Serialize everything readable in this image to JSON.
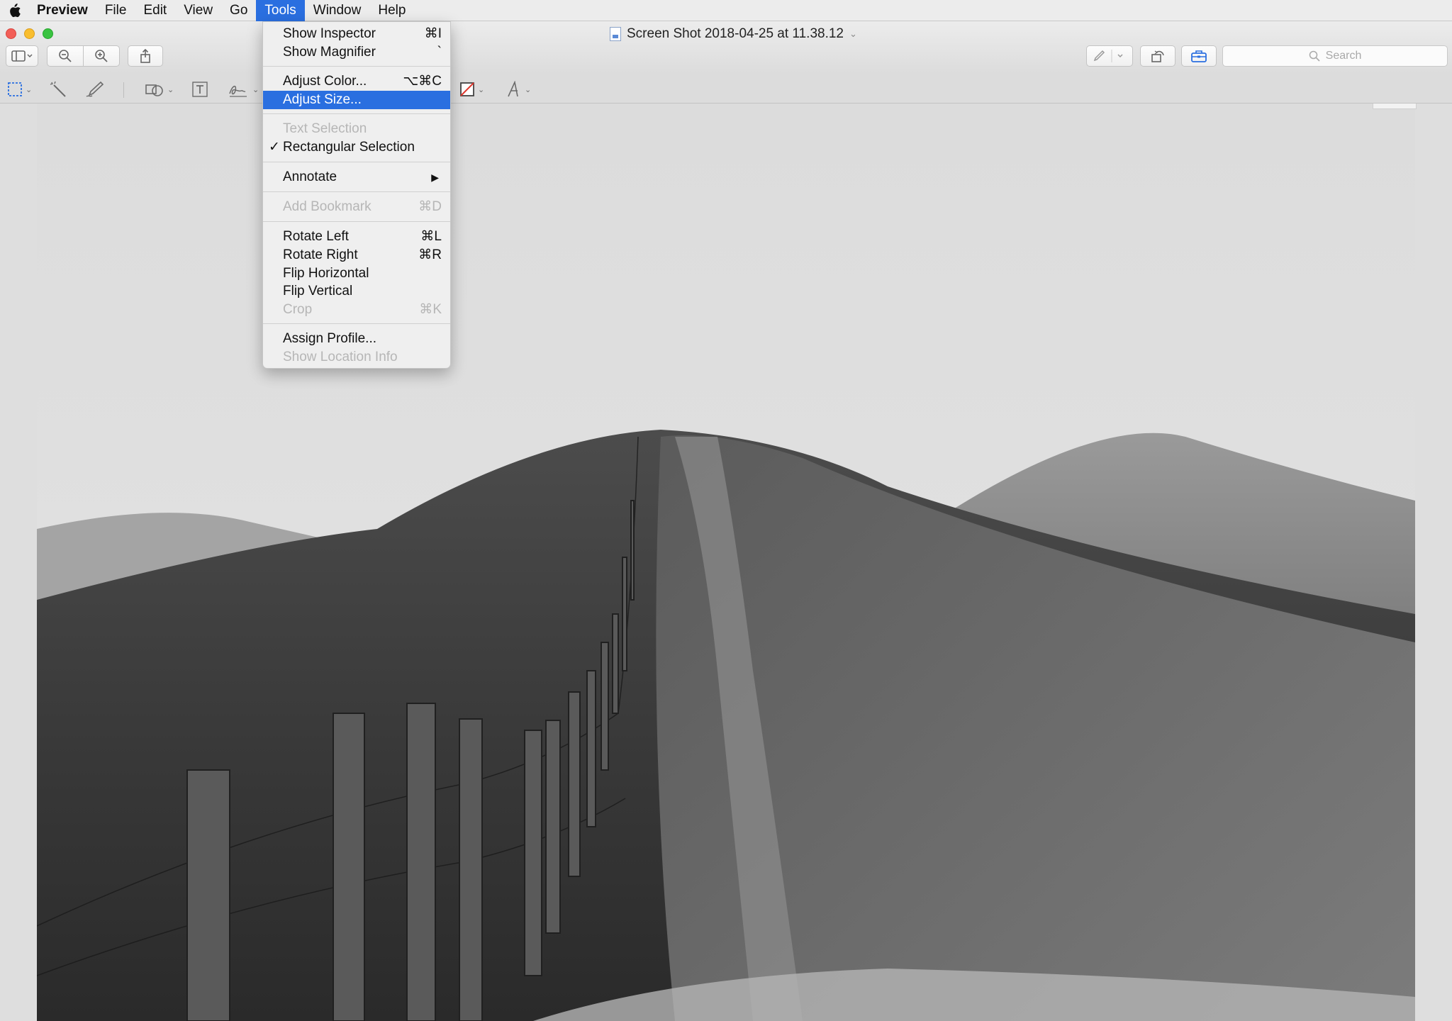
{
  "menubar": {
    "app": "Preview",
    "items": [
      "File",
      "Edit",
      "View",
      "Go",
      "Tools",
      "Window",
      "Help"
    ],
    "active_item": "Tools"
  },
  "window": {
    "title": "Screen Shot 2018-04-25 at 11.38.12",
    "search_placeholder": "Search"
  },
  "tools_menu": {
    "show_inspector": {
      "label": "Show Inspector",
      "shortcut": "⌘I"
    },
    "show_magnifier": {
      "label": "Show Magnifier",
      "shortcut": "`"
    },
    "adjust_color": {
      "label": "Adjust Color...",
      "shortcut": "⌥⌘C"
    },
    "adjust_size": {
      "label": "Adjust Size..."
    },
    "text_selection": {
      "label": "Text Selection"
    },
    "rect_selection": {
      "label": "Rectangular Selection",
      "check": "✓"
    },
    "annotate": {
      "label": "Annotate",
      "arrow": "▶"
    },
    "add_bookmark": {
      "label": "Add Bookmark",
      "shortcut": "⌘D"
    },
    "rotate_left": {
      "label": "Rotate Left",
      "shortcut": "⌘L"
    },
    "rotate_right": {
      "label": "Rotate Right",
      "shortcut": "⌘R"
    },
    "flip_horizontal": {
      "label": "Flip Horizontal"
    },
    "flip_vertical": {
      "label": "Flip Vertical"
    },
    "crop": {
      "label": "Crop",
      "shortcut": "⌘K"
    },
    "assign_profile": {
      "label": "Assign Profile..."
    },
    "show_location": {
      "label": "Show Location Info"
    }
  },
  "icons": {
    "apple": "apple-icon",
    "sidebar": "sidebar-icon",
    "zoom_out": "zoom-out-icon",
    "zoom_in": "zoom-in-icon",
    "share": "share-icon",
    "markup": "pen-icon",
    "rotate": "rotate-icon",
    "toolbox": "toolbox-icon",
    "search": "search-icon"
  },
  "colors": {
    "highlight": "#2a6fe0",
    "menu_bg": "#efefef"
  }
}
